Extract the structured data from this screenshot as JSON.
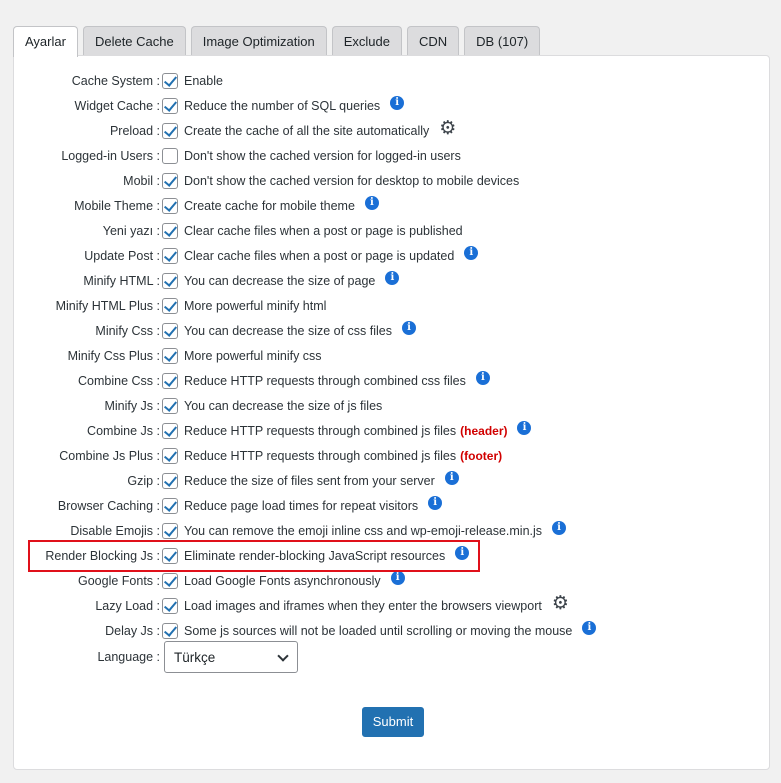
{
  "tabs": [
    {
      "label": "Ayarlar",
      "active": true
    },
    {
      "label": "Delete Cache"
    },
    {
      "label": "Image Optimization"
    },
    {
      "label": "Exclude"
    },
    {
      "label": "CDN"
    },
    {
      "label": "DB (107)"
    }
  ],
  "settings": [
    {
      "label": "Cache System :",
      "checked": true,
      "desc": "Enable"
    },
    {
      "label": "Widget Cache :",
      "checked": true,
      "desc": "Reduce the number of SQL queries",
      "icon": "info-icon"
    },
    {
      "label": "Preload :",
      "checked": true,
      "desc": "Create the cache of all the site automatically",
      "icon": "gear-icon"
    },
    {
      "label": "Logged-in Users :",
      "checked": false,
      "desc": "Don't show the cached version for logged-in users"
    },
    {
      "label": "Mobil :",
      "checked": true,
      "desc": "Don't show the cached version for desktop to mobile devices"
    },
    {
      "label": "Mobile Theme :",
      "checked": true,
      "desc": "Create cache for mobile theme",
      "icon": "info-icon"
    },
    {
      "label": "Yeni yazı :",
      "checked": true,
      "desc": "Clear cache files when a post or page is published"
    },
    {
      "label": "Update Post :",
      "checked": true,
      "desc": "Clear cache files when a post or page is updated",
      "icon": "info-icon"
    },
    {
      "label": "Minify HTML :",
      "checked": true,
      "desc": "You can decrease the size of page",
      "icon": "info-icon"
    },
    {
      "label": "Minify HTML Plus :",
      "checked": true,
      "desc": "More powerful minify html"
    },
    {
      "label": "Minify Css :",
      "checked": true,
      "desc": "You can decrease the size of css files",
      "icon": "info-icon"
    },
    {
      "label": "Minify Css Plus :",
      "checked": true,
      "desc": "More powerful minify css"
    },
    {
      "label": "Combine Css :",
      "checked": true,
      "desc": "Reduce HTTP requests through combined css files",
      "icon": "info-icon"
    },
    {
      "label": "Minify Js :",
      "checked": true,
      "desc": "You can decrease the size of js files"
    },
    {
      "label": "Combine Js :",
      "checked": true,
      "desc": "Reduce HTTP requests through combined js files",
      "note": "(header)",
      "icon": "info-icon"
    },
    {
      "label": "Combine Js Plus :",
      "checked": true,
      "desc": " Reduce HTTP requests through combined js files",
      "note": "(footer)"
    },
    {
      "label": "Gzip :",
      "checked": true,
      "desc": "Reduce the size of files sent from your server",
      "icon": "info-icon"
    },
    {
      "label": "Browser Caching :",
      "checked": true,
      "desc": "Reduce page load times for repeat visitors",
      "icon": "info-icon"
    },
    {
      "label": "Disable Emojis :",
      "checked": true,
      "desc": "You can remove the emoji inline css and wp-emoji-release.min.js",
      "icon": "info-icon"
    },
    {
      "label": "Render Blocking Js :",
      "checked": true,
      "desc": "Eliminate render-blocking JavaScript resources",
      "icon": "info-icon",
      "highlighted": true
    },
    {
      "label": "Google Fonts :",
      "checked": true,
      "desc": "Load Google Fonts asynchronously",
      "icon": "info-icon"
    },
    {
      "label": "Lazy Load :",
      "checked": true,
      "desc": "Load images and iframes when they enter the browsers viewport",
      "icon": "gear-icon"
    },
    {
      "label": "Delay Js :",
      "checked": true,
      "desc": "Some js sources will not be loaded until scrolling or moving the mouse",
      "icon": "info-icon"
    }
  ],
  "language": {
    "label": "Language :",
    "selected": "Türkçe"
  },
  "submit_label": "Submit",
  "colors": {
    "accent": "#2271b1",
    "info": "#1a6fd6",
    "highlight": "#e0101a",
    "note": "#d10000"
  }
}
